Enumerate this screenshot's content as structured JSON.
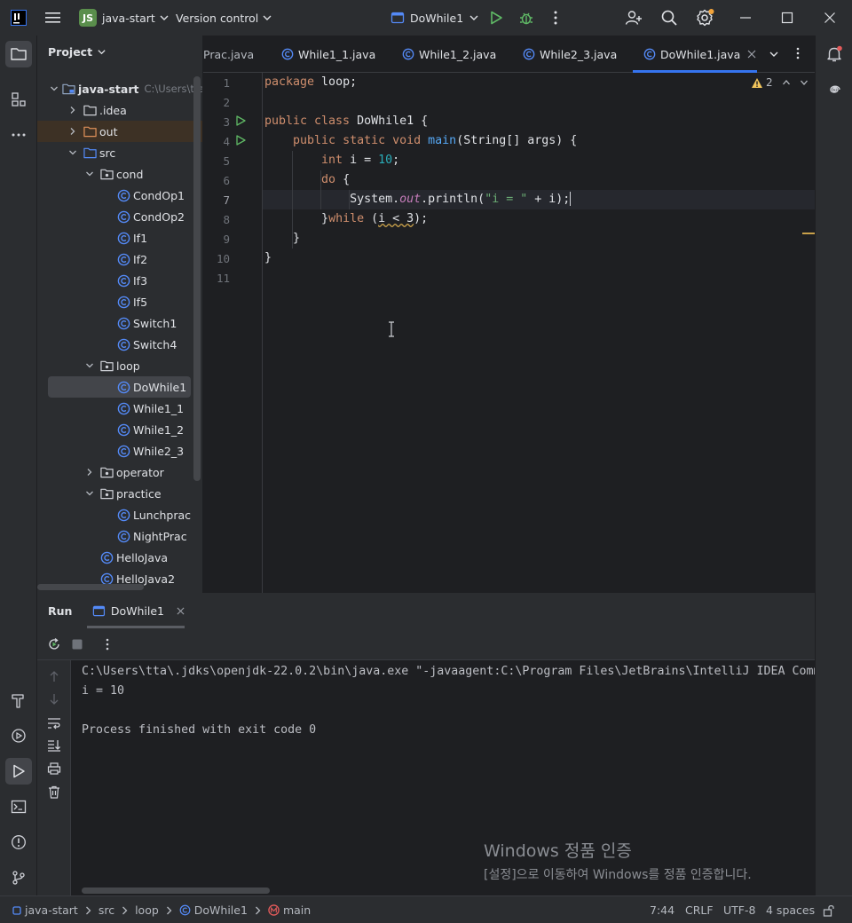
{
  "titlebar": {
    "project_badge": "JS",
    "project_name": "java-start",
    "vcs_label": "Version control",
    "run_config": "DoWhile1"
  },
  "project_panel": {
    "title": "Project",
    "root_label": "java-start",
    "root_path": "C:\\Users\\tta",
    "tree": [
      {
        "label": "java-start",
        "icon": "module-folder-icon"
      },
      {
        "label": ".idea",
        "icon": "folder-icon"
      },
      {
        "label": "out",
        "icon": "excluded-folder-icon"
      },
      {
        "label": "src",
        "icon": "source-folder-icon"
      },
      {
        "label": "cond",
        "icon": "package-icon"
      },
      {
        "label": "CondOp1",
        "icon": "java-class-icon"
      },
      {
        "label": "CondOp2",
        "icon": "java-class-icon"
      },
      {
        "label": "If1",
        "icon": "java-class-icon"
      },
      {
        "label": "If2",
        "icon": "java-class-icon"
      },
      {
        "label": "If3",
        "icon": "java-class-icon"
      },
      {
        "label": "If5",
        "icon": "java-class-icon"
      },
      {
        "label": "Switch1",
        "icon": "java-class-icon"
      },
      {
        "label": "Switch4",
        "icon": "java-class-icon"
      },
      {
        "label": "loop",
        "icon": "package-icon"
      },
      {
        "label": "DoWhile1",
        "icon": "java-class-icon"
      },
      {
        "label": "While1_1",
        "icon": "java-class-icon"
      },
      {
        "label": "While1_2",
        "icon": "java-class-icon"
      },
      {
        "label": "While2_3",
        "icon": "java-class-icon"
      },
      {
        "label": "operator",
        "icon": "package-icon"
      },
      {
        "label": "practice",
        "icon": "package-icon"
      },
      {
        "label": "Lunchprac",
        "icon": "java-class-icon"
      },
      {
        "label": "NightPrac",
        "icon": "java-class-icon"
      },
      {
        "label": "HelloJava",
        "icon": "java-class-icon"
      },
      {
        "label": "HelloJava2",
        "icon": "java-class-icon"
      }
    ]
  },
  "editor": {
    "tabs": [
      {
        "label": "Prac.java"
      },
      {
        "label": "While1_1.java"
      },
      {
        "label": "While1_2.java"
      },
      {
        "label": "While2_3.java"
      },
      {
        "label": "DoWhile1.java",
        "active": true
      }
    ],
    "warning_count": "2",
    "line_numbers": [
      "1",
      "2",
      "3",
      "4",
      "5",
      "6",
      "7",
      "8",
      "9",
      "10",
      "11"
    ],
    "code_lines": [
      "package loop;",
      "",
      "public class DoWhile1 {",
      "    public static void main(String[] args) {",
      "        int i = 10;",
      "        do {",
      "            System.out.println(\"i = \" + i);",
      "        }while (i < 3);",
      "    }",
      "}",
      ""
    ]
  },
  "run_panel": {
    "title": "Run",
    "tab_label": "DoWhile1",
    "console_lines": [
      "C:\\Users\\tta\\.jdks\\openjdk-22.0.2\\bin\\java.exe \"-javaagent:C:\\Program Files\\JetBrains\\IntelliJ IDEA Community",
      "i = 10",
      "",
      "Process finished with exit code 0"
    ]
  },
  "watermark": {
    "title": "Windows 정품 인증",
    "subtitle": "[설정]으로 이동하여 Windows를 정품 인증합니다."
  },
  "statusbar": {
    "breadcrumbs": [
      "java-start",
      "src",
      "loop",
      "DoWhile1",
      "main"
    ],
    "caret": "7:44",
    "line_sep": "CRLF",
    "encoding": "UTF-8",
    "indent": "4 spaces"
  },
  "colors": {
    "background": "#1e1f22",
    "panel": "#2b2d30",
    "accent": "#3574f0",
    "keyword": "#cf8e6d",
    "function": "#56a8f5",
    "number": "#2aacb8",
    "string": "#6aab73",
    "run_green": "#5fb865",
    "notification_dot": "#f2a33a"
  }
}
